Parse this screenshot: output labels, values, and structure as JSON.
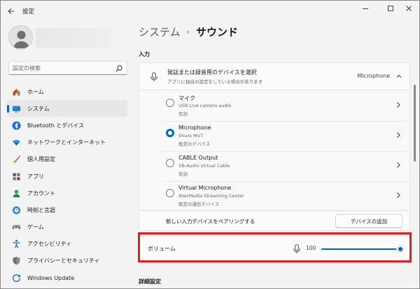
{
  "window": {
    "title": "設定",
    "controls": [
      "minimize-icon",
      "maximize-icon",
      "close-icon"
    ]
  },
  "search": {
    "placeholder": "設定の検索"
  },
  "sidebar": {
    "items": [
      {
        "label": "ホーム",
        "icon": "home-icon",
        "active": false
      },
      {
        "label": "システム",
        "icon": "system-display-icon",
        "active": true
      },
      {
        "label": "Bluetooth とデバイス",
        "icon": "bluetooth-icon",
        "active": false
      },
      {
        "label": "ネットワークとインターネット",
        "icon": "wifi-icon",
        "active": false
      },
      {
        "label": "個人用設定",
        "icon": "brush-icon",
        "active": false
      },
      {
        "label": "アプリ",
        "icon": "apps-icon",
        "active": false
      },
      {
        "label": "アカウント",
        "icon": "account-icon",
        "active": false
      },
      {
        "label": "時刻と言語",
        "icon": "globe-clock-icon",
        "active": false
      },
      {
        "label": "ゲーム",
        "icon": "gamepad-icon",
        "active": false
      },
      {
        "label": "アクセシビリティ",
        "icon": "accessibility-icon",
        "active": false
      },
      {
        "label": "プライバシーとセキュリティ",
        "icon": "shield-icon",
        "active": false
      },
      {
        "label": "Windows Update",
        "icon": "update-icon",
        "active": false
      }
    ]
  },
  "breadcrumb": {
    "parent": "システム",
    "separator": "›",
    "current": "サウンド"
  },
  "input_section": {
    "title": "入力",
    "header": {
      "title": "発話または録音用のデバイスを選択",
      "subtitle": "アプリに独自の設定をしている場合があります",
      "value": "Microphone"
    },
    "devices": [
      {
        "name": "マイク",
        "model": "USB Live camera audio",
        "status": "有効",
        "selected": false
      },
      {
        "name": "Microphone",
        "model": "Shure MV7",
        "status": "既定のデバイス",
        "selected": true
      },
      {
        "name": "CABLE Output",
        "model": "VB-Audio Virtual Cable",
        "status": "有効",
        "selected": false
      },
      {
        "name": "Virtual Microphone",
        "model": "AVerMedia Streaming Center",
        "status": "既定の通信デバイス",
        "selected": false
      }
    ],
    "pair": {
      "label": "新しい入力デバイスをペアリングする",
      "button": "デバイスの追加"
    },
    "volume": {
      "label": "ボリューム",
      "value": "100",
      "level": 100
    }
  },
  "advanced": {
    "title": "詳細設定"
  },
  "colors": {
    "accent": "#0067c0",
    "highlight": "#e01e1e"
  }
}
